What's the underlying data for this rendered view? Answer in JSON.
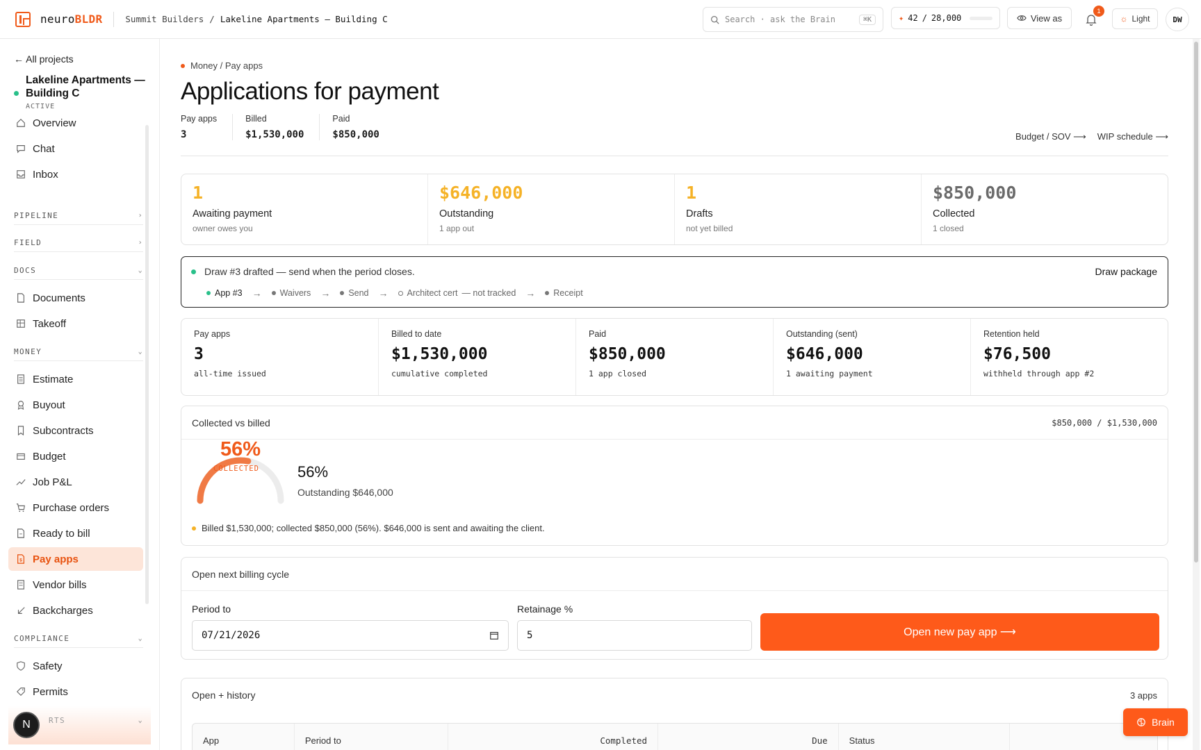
{
  "header": {
    "logo_prefix": "neuro",
    "logo_suffix": "BLDR",
    "breadcrumb": [
      "Summit Builders",
      "/",
      "Lakeline Apartments — Building C"
    ],
    "search_placeholder": "Search · ask the Brain",
    "search_shortcut": "⌘K",
    "credits_used": "42",
    "credits_total": "28,000",
    "credits_fraction": 0.0015,
    "view_as_label": "View as",
    "notification_count": "1",
    "theme_label": "Light",
    "avatar_initials": "DW"
  },
  "sidebar": {
    "back_label": "← All projects",
    "project_name": "Lakeline Apartments — Building C",
    "project_status": "ACTIVE",
    "top_items": [
      {
        "label": "Overview",
        "icon": "home-icon"
      },
      {
        "label": "Chat",
        "icon": "chat-icon"
      },
      {
        "label": "Inbox",
        "icon": "inbox-icon"
      }
    ],
    "sections": {
      "pipeline": {
        "label": "PIPELINE",
        "expanded": false
      },
      "field": {
        "label": "FIELD",
        "expanded": false
      },
      "docs": {
        "label": "DOCS",
        "expanded": true
      },
      "money": {
        "label": "MONEY",
        "expanded": true
      },
      "compliance": {
        "label": "COMPLIANCE",
        "expanded": true
      },
      "reports_partial": {
        "label": "RTS",
        "expanded": true
      }
    },
    "docs_items": [
      {
        "label": "Documents",
        "icon": "document-icon"
      },
      {
        "label": "Takeoff",
        "icon": "grid-icon"
      }
    ],
    "money_items": [
      {
        "label": "Estimate",
        "icon": "calculator-icon"
      },
      {
        "label": "Buyout",
        "icon": "award-icon"
      },
      {
        "label": "Subcontracts",
        "icon": "bookmark-icon"
      },
      {
        "label": "Budget",
        "icon": "wallet-icon"
      },
      {
        "label": "Job P&L",
        "icon": "trend-icon"
      },
      {
        "label": "Purchase orders",
        "icon": "cart-icon"
      },
      {
        "label": "Ready to bill",
        "icon": "receipt-icon"
      },
      {
        "label": "Pay apps",
        "icon": "pay-app-icon",
        "active": true
      },
      {
        "label": "Vendor bills",
        "icon": "bill-icon"
      },
      {
        "label": "Backcharges",
        "icon": "return-arrow-icon"
      }
    ],
    "compliance_items": [
      {
        "label": "Safety",
        "icon": "shield-icon"
      },
      {
        "label": "Permits",
        "icon": "tag-icon"
      }
    ],
    "fab_letter": "N"
  },
  "page": {
    "breadcrumb": "Money / Pay apps",
    "title": "Applications for payment",
    "mini_stats": [
      {
        "label": "Pay apps",
        "value": "3"
      },
      {
        "label": "Billed",
        "value": "$1,530,000"
      },
      {
        "label": "Paid",
        "value": "$850,000"
      }
    ],
    "links": [
      "Budget / SOV ⟶",
      "WIP schedule ⟶"
    ]
  },
  "kpis": [
    {
      "value": "1",
      "title": "Awaiting payment",
      "sub": "owner owes you",
      "color": "#f5b227"
    },
    {
      "value": "$646,000",
      "title": "Outstanding",
      "sub": "1 app out",
      "color": "#f5b227"
    },
    {
      "value": "1",
      "title": "Drafts",
      "sub": "not yet billed",
      "color": "#f5b227"
    },
    {
      "value": "$850,000",
      "title": "Collected",
      "sub": "1 closed",
      "color": "#6a6a6a"
    }
  ],
  "draw_banner": {
    "message": "Draw #3 drafted — send when the period closes.",
    "action": "Draw package",
    "steps": [
      {
        "label": "App #3",
        "state": "current"
      },
      {
        "label": "Waivers",
        "state": "done"
      },
      {
        "label": "Send",
        "state": "done"
      },
      {
        "label": "Architect cert",
        "note": "— not tracked",
        "state": "open"
      },
      {
        "label": "Receipt",
        "state": "done"
      }
    ]
  },
  "stats": [
    {
      "label": "Pay apps",
      "value": "3",
      "sub": "all-time issued"
    },
    {
      "label": "Billed to date",
      "value": "$1,530,000",
      "sub": "cumulative completed"
    },
    {
      "label": "Paid",
      "value": "$850,000",
      "sub": "1 app closed"
    },
    {
      "label": "Outstanding (sent)",
      "value": "$646,000",
      "sub": "1 awaiting payment"
    },
    {
      "label": "Retention held",
      "value": "$76,500",
      "sub": "withheld through app #2"
    }
  ],
  "collected": {
    "title": "Collected vs billed",
    "ratio": "$850,000 / $1,530,000",
    "percent": 56,
    "percent_label": "56%",
    "gauge_caption": "COLLECTED",
    "outstanding_label": "Outstanding $646,000",
    "note": "Billed $1,530,000; collected $850,000 (56%). $646,000 is sent and awaiting the client.",
    "accent": "#f05a1a"
  },
  "billing_cycle": {
    "title": "Open next billing cycle",
    "period_label": "Period to",
    "period_value": "07/21/2026",
    "retainage_label": "Retainage %",
    "retainage_value": "5",
    "button_label": "Open new pay app ⟶"
  },
  "history": {
    "title": "Open + history",
    "count": "3 apps",
    "columns": [
      "App",
      "Period to",
      "Completed",
      "Due",
      "Status",
      ""
    ]
  },
  "brain_button": "Brain"
}
